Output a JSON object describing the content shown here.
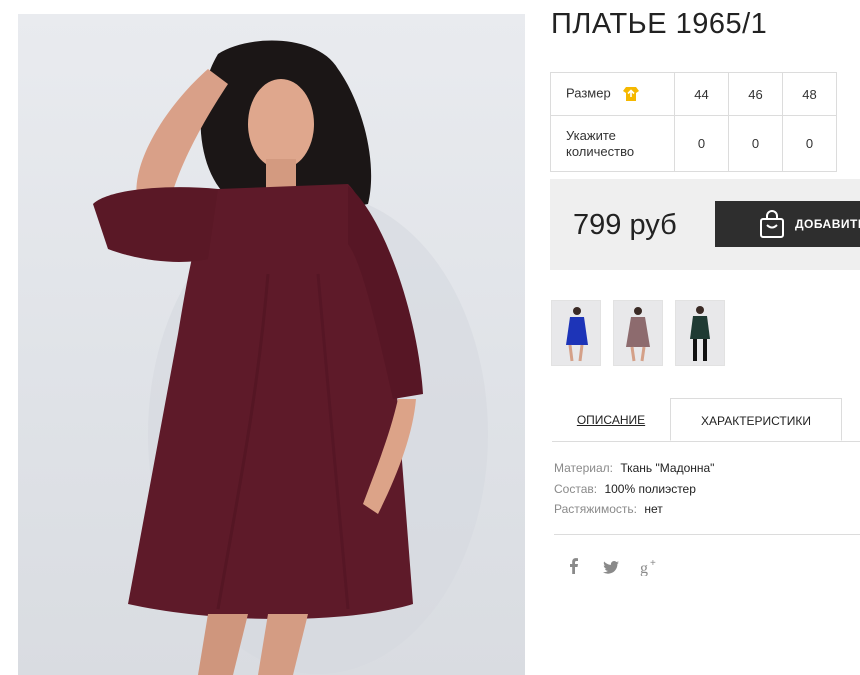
{
  "product": {
    "title": "ПЛАТЬЕ 1965/1",
    "size_row_label": "Размер",
    "qty_row_label": "Укажите количество",
    "sizes": [
      "44",
      "46",
      "48"
    ],
    "quantities": [
      "0",
      "0",
      "0"
    ],
    "price": "799 руб",
    "add_to_cart": "ДОБАВИТЬ"
  },
  "thumbnails": [
    {
      "alt": "blue dress",
      "color": "#1d34b8"
    },
    {
      "alt": "burgundy dress",
      "color": "#8d6b6e"
    },
    {
      "alt": "green dress",
      "color": "#1f3a33"
    }
  ],
  "tabs": {
    "description": "ОПИСАНИЕ",
    "characteristics": "ХАРАКТЕРИСТИКИ"
  },
  "properties": [
    {
      "key": "Материал:",
      "value": "Ткань \"Мадонна\""
    },
    {
      "key": "Состав:",
      "value": "100% полиэстер"
    },
    {
      "key": "Растяжимость:",
      "value": "нет"
    }
  ],
  "social": [
    "facebook-icon",
    "twitter-icon",
    "google-plus-icon"
  ],
  "colors": {
    "dress": "#5e1a29",
    "accent": "#f5b800",
    "button": "#2e2e2e"
  }
}
